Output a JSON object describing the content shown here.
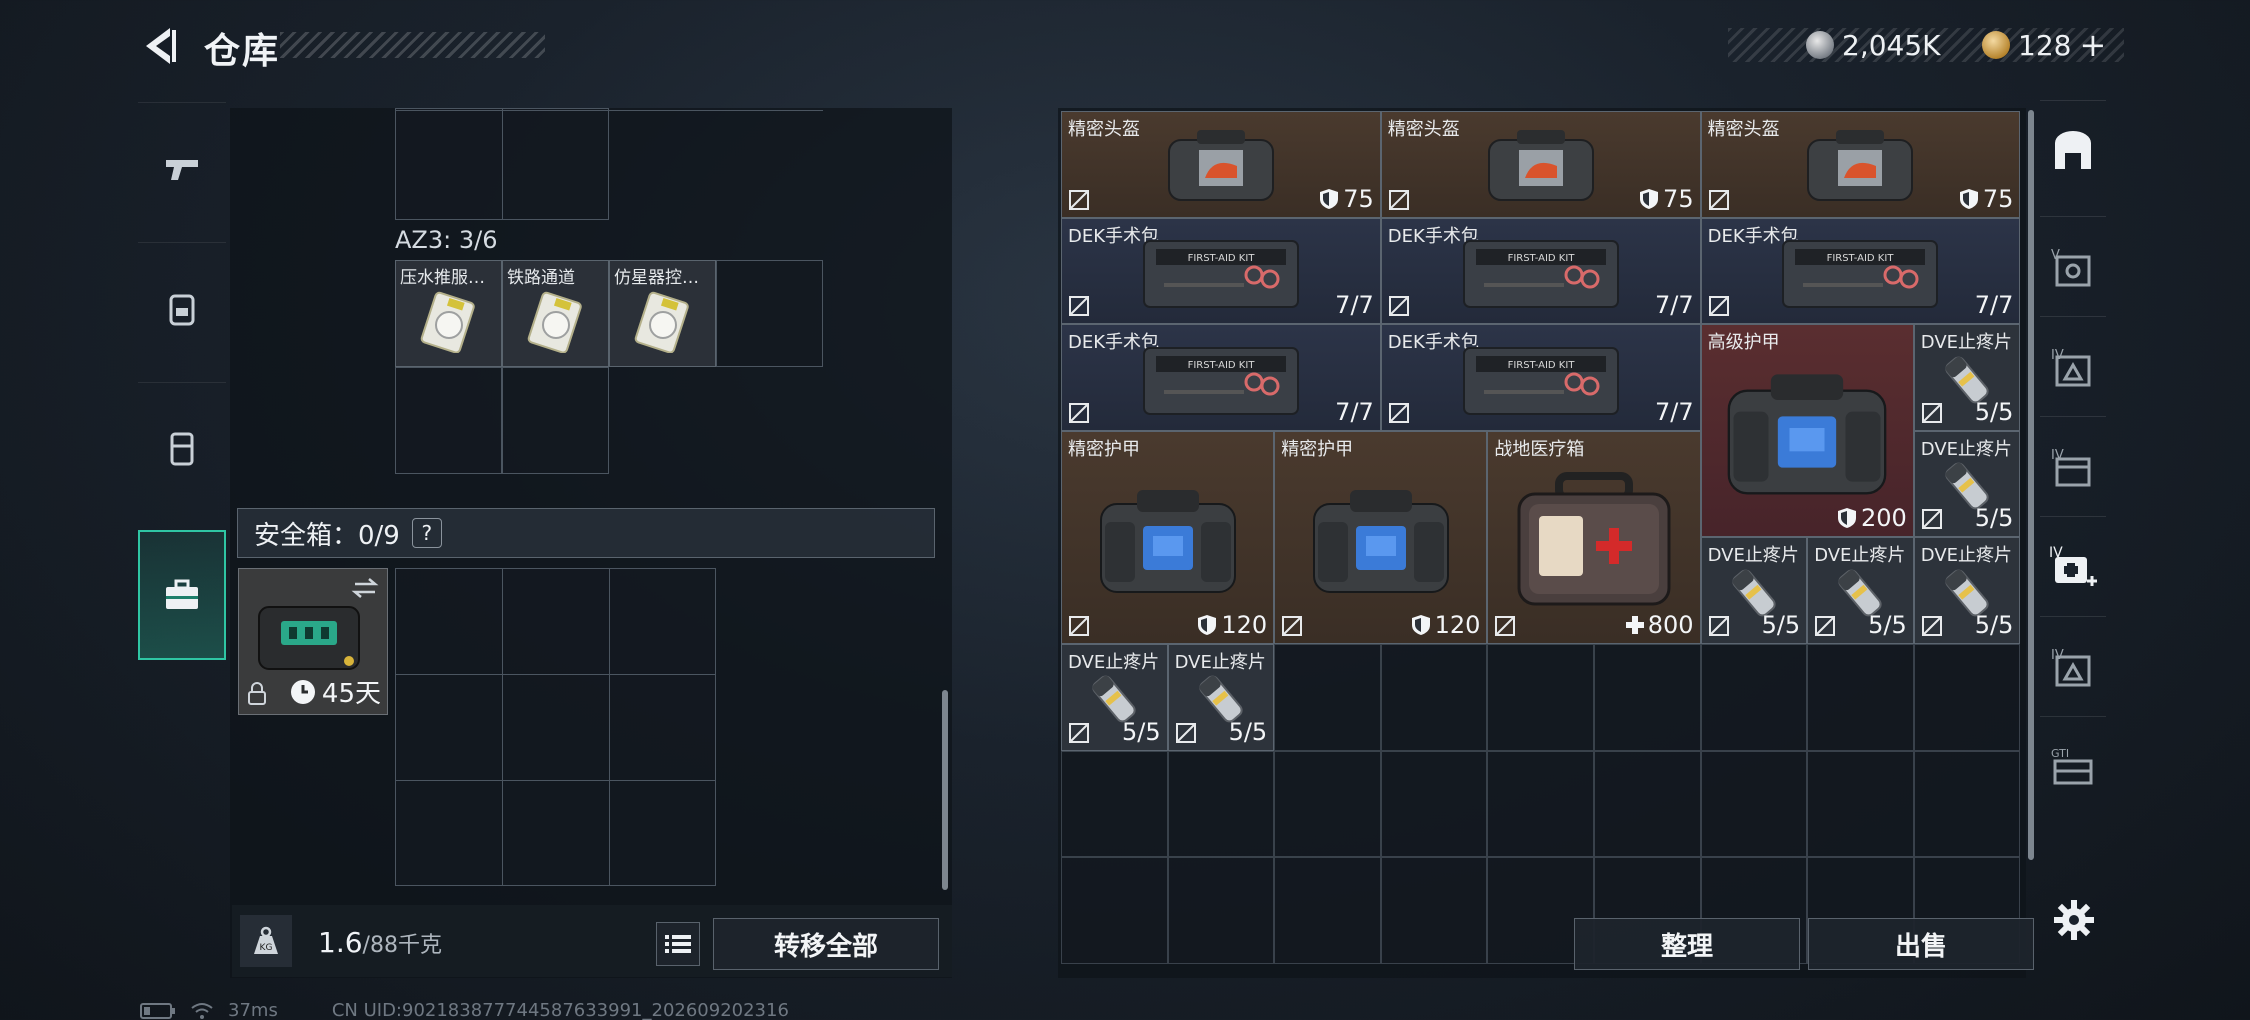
{
  "header": {
    "title": "仓库",
    "currency": [
      {
        "icon": "silver-coin-icon",
        "value": "2,045K"
      },
      {
        "icon": "gold-coin-icon",
        "value": "128"
      }
    ],
    "add_symbol": "+"
  },
  "left_nav": [
    {
      "icon": "pistol-icon"
    },
    {
      "icon": "backpack-icon"
    },
    {
      "icon": "vest-icon"
    },
    {
      "icon": "briefcase-icon",
      "active": true
    }
  ],
  "container": {
    "az3_label": "AZ3: 3/6",
    "az3_items": [
      {
        "label": "压水推服…"
      },
      {
        "label": "铁路通道"
      },
      {
        "label": "仿星器控…"
      }
    ],
    "safebox_label": "安全箱：0/9",
    "help_symbol": "?",
    "safe_case": {
      "timer": "45天"
    },
    "weight": {
      "value": "1.6",
      "unit": "/88千克"
    },
    "transfer_all": "转移全部"
  },
  "stash": {
    "items": [
      {
        "label": "精密头盔",
        "value": "75",
        "kind": "helmet"
      },
      {
        "label": "精密头盔",
        "value": "75",
        "kind": "helmet"
      },
      {
        "label": "精密头盔",
        "value": "75",
        "kind": "helmet"
      },
      {
        "label": "DEK手术包",
        "value": "7/7",
        "kind": "kit"
      },
      {
        "label": "DEK手术包",
        "value": "7/7",
        "kind": "kit"
      },
      {
        "label": "DEK手术包",
        "value": "7/7",
        "kind": "kit"
      },
      {
        "label": "DEK手术包",
        "value": "7/7",
        "kind": "kit"
      },
      {
        "label": "DEK手术包",
        "value": "7/7",
        "kind": "kit"
      },
      {
        "label": "高级护甲",
        "value": "200",
        "kind": "armor-adv"
      },
      {
        "label": "DVE止疼片",
        "value": "5/5",
        "kind": "pill"
      },
      {
        "label": "DVE止疼片",
        "value": "5/5",
        "kind": "pill"
      },
      {
        "label": "精密护甲",
        "value": "120",
        "kind": "armor"
      },
      {
        "label": "精密护甲",
        "value": "120",
        "kind": "armor"
      },
      {
        "label": "战地医疗箱",
        "value": "800",
        "kind": "medbox"
      },
      {
        "label": "DVE止疼片",
        "value": "5/5",
        "kind": "pill"
      },
      {
        "label": "DVE止疼片",
        "value": "5/5",
        "kind": "pill"
      },
      {
        "label": "DVE止疼片",
        "value": "5/5",
        "kind": "pill"
      },
      {
        "label": "DVE止疼片",
        "value": "5/5",
        "kind": "pill"
      },
      {
        "label": "DVE止疼片",
        "value": "5/5",
        "kind": "pill"
      }
    ],
    "sort_button": "整理",
    "sell_button": "出售"
  },
  "right_nav": [
    {
      "icon": "stash-icon"
    },
    {
      "icon": "tier-v-case-icon"
    },
    {
      "icon": "tier-iv-case-icon"
    },
    {
      "icon": "tier-iv-box-icon"
    },
    {
      "icon": "tier-iv-medical-icon"
    },
    {
      "icon": "tier-iv-case-2-icon"
    },
    {
      "icon": "gti-case-icon"
    }
  ],
  "footer": {
    "ping": "37ms",
    "uid": "CN UID:902183877744587633991_202609202316"
  }
}
